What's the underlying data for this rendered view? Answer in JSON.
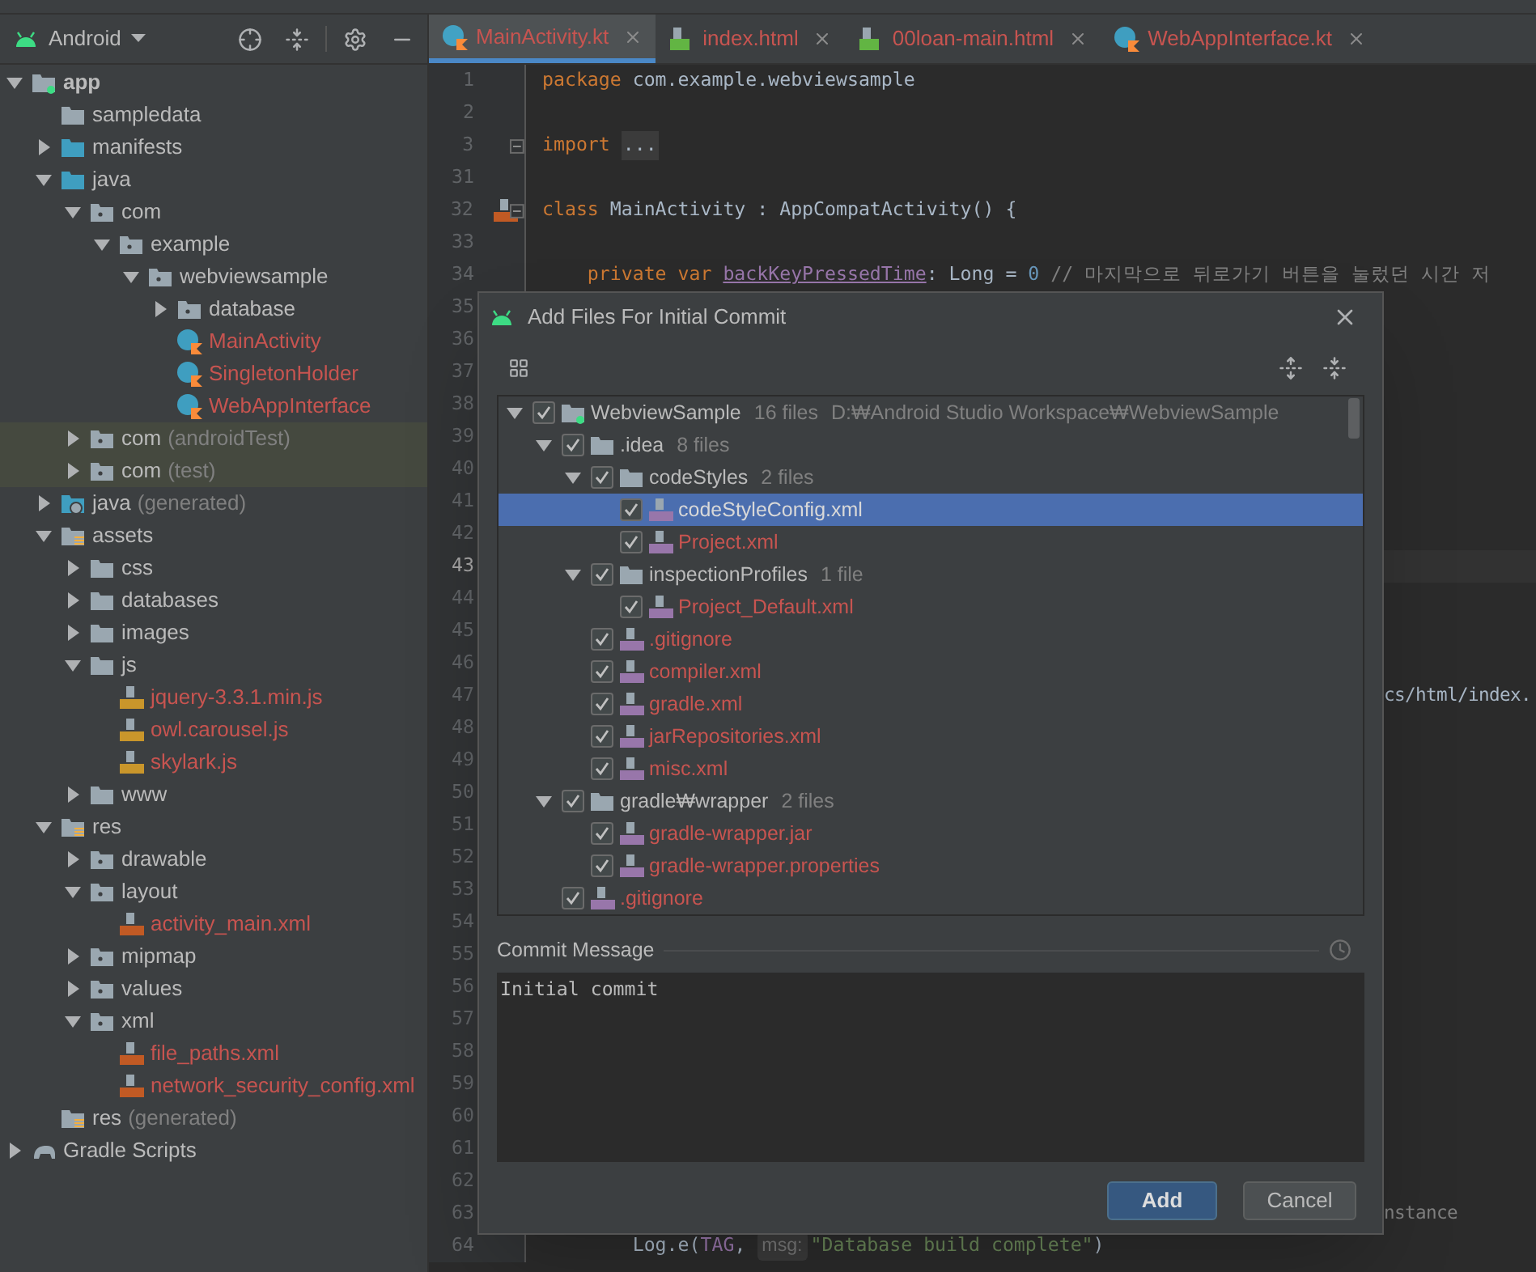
{
  "project_panel": {
    "view": "Android",
    "tree": [
      {
        "label": "app",
        "kind": "module",
        "expanded": true,
        "bold": true,
        "children": [
          {
            "label": "sampledata",
            "kind": "folder"
          },
          {
            "label": "manifests",
            "kind": "source",
            "expanded": false
          },
          {
            "label": "java",
            "kind": "source",
            "expanded": true,
            "children": [
              {
                "label": "com",
                "kind": "package",
                "expanded": true,
                "children": [
                  {
                    "label": "example",
                    "kind": "package",
                    "expanded": true,
                    "children": [
                      {
                        "label": "webviewsample",
                        "kind": "package",
                        "expanded": true,
                        "children": [
                          {
                            "label": "database",
                            "kind": "package",
                            "expanded": false
                          },
                          {
                            "label": "MainActivity",
                            "kind": "kotlin",
                            "unversioned": true
                          },
                          {
                            "label": "SingletonHolder",
                            "kind": "kotlin",
                            "unversioned": true
                          },
                          {
                            "label": "WebAppInterface",
                            "kind": "kotlin",
                            "unversioned": true
                          }
                        ]
                      }
                    ]
                  }
                ]
              },
              {
                "label": "com",
                "suffix": "(androidTest)",
                "kind": "package",
                "expanded": false,
                "highlighted": true
              },
              {
                "label": "com",
                "suffix": "(test)",
                "kind": "package",
                "expanded": false,
                "highlighted": true
              }
            ]
          },
          {
            "label": "java",
            "suffix": "(generated)",
            "kind": "generated",
            "expanded": false
          },
          {
            "label": "assets",
            "kind": "resources",
            "expanded": true,
            "children": [
              {
                "label": "css",
                "kind": "folder",
                "expanded": false
              },
              {
                "label": "databases",
                "kind": "folder",
                "expanded": false
              },
              {
                "label": "images",
                "kind": "folder",
                "expanded": false
              },
              {
                "label": "js",
                "kind": "folder",
                "expanded": true,
                "children": [
                  {
                    "label": "jquery-3.3.1.min.js",
                    "kind": "js",
                    "unversioned": true
                  },
                  {
                    "label": "owl.carousel.js",
                    "kind": "js",
                    "unversioned": true
                  },
                  {
                    "label": "skylark.js",
                    "kind": "js",
                    "unversioned": true
                  }
                ]
              },
              {
                "label": "www",
                "kind": "folder",
                "expanded": false
              }
            ]
          },
          {
            "label": "res",
            "kind": "resources",
            "expanded": true,
            "children": [
              {
                "label": "drawable",
                "kind": "package",
                "expanded": false
              },
              {
                "label": "layout",
                "kind": "package",
                "expanded": true,
                "children": [
                  {
                    "label": "activity_main.xml",
                    "kind": "xml",
                    "unversioned": true
                  }
                ]
              },
              {
                "label": "mipmap",
                "kind": "package",
                "expanded": false
              },
              {
                "label": "values",
                "kind": "package",
                "expanded": false
              },
              {
                "label": "xml",
                "kind": "package",
                "expanded": true,
                "children": [
                  {
                    "label": "file_paths.xml",
                    "kind": "xml",
                    "unversioned": true
                  },
                  {
                    "label": "network_security_config.xml",
                    "kind": "xml",
                    "unversioned": true
                  }
                ]
              }
            ]
          },
          {
            "label": "res",
            "suffix": "(generated)",
            "kind": "resources"
          }
        ]
      },
      {
        "label": "Gradle Scripts",
        "kind": "gradle",
        "expanded": false
      }
    ]
  },
  "tabs": [
    {
      "label": "MainActivity.kt",
      "kind": "kotlin",
      "selected": true
    },
    {
      "label": "index.html",
      "kind": "html",
      "selected": false
    },
    {
      "label": "00loan-main.html",
      "kind": "html",
      "selected": false
    },
    {
      "label": "WebAppInterface.kt",
      "kind": "kotlin",
      "selected": false
    }
  ],
  "editor": {
    "lines": [
      {
        "number": "1",
        "segments": [
          {
            "kind": "keyword",
            "text": "package "
          },
          {
            "kind": "plain",
            "text": "com.example.webviewsample"
          }
        ]
      },
      {
        "number": "2"
      },
      {
        "number": "3",
        "fold": true,
        "segments": [
          {
            "kind": "keyword",
            "text": "import "
          },
          {
            "kind": "folded",
            "text": "..."
          }
        ]
      },
      {
        "number": "31"
      },
      {
        "number": "32",
        "fold": true,
        "gutter_icon": true,
        "segments": [
          {
            "kind": "keyword",
            "text": "class "
          },
          {
            "kind": "plain",
            "text": "MainActivity : AppCompatActivity() {"
          }
        ]
      },
      {
        "number": "33"
      },
      {
        "number": "34",
        "segments": [
          {
            "kind": "keyword",
            "text": "    private var "
          },
          {
            "kind": "field",
            "text": "backKeyPressedTime"
          },
          {
            "kind": "plain",
            "text": ": Long = "
          },
          {
            "kind": "number",
            "text": "0"
          },
          {
            "kind": "comment",
            "text": " // 마지막으로 뒤로가기 버튼을 눌렀던 시간 저"
          }
        ]
      },
      {
        "number": "35"
      },
      {
        "number": "36"
      },
      {
        "number": "37"
      },
      {
        "number": "38"
      },
      {
        "number": "39"
      },
      {
        "number": "40"
      },
      {
        "number": "41"
      },
      {
        "number": "42"
      },
      {
        "number": "43",
        "current": true
      },
      {
        "number": "44"
      },
      {
        "number": "45"
      },
      {
        "number": "46"
      },
      {
        "number": "47",
        "tail": [
          {
            "kind": "plain",
            "text": "cs/html/index."
          }
        ]
      },
      {
        "number": "48"
      },
      {
        "number": "49"
      },
      {
        "number": "50"
      },
      {
        "number": "51"
      },
      {
        "number": "52"
      },
      {
        "number": "53"
      },
      {
        "number": "54"
      },
      {
        "number": "55"
      },
      {
        "number": "56"
      },
      {
        "number": "57"
      },
      {
        "number": "58"
      },
      {
        "number": "59"
      },
      {
        "number": "60"
      },
      {
        "number": "61"
      },
      {
        "number": "62"
      },
      {
        "number": "63",
        "tail": [
          {
            "kind": "comment",
            "text": "nstance"
          }
        ]
      },
      {
        "number": "64",
        "segments": [
          {
            "kind": "plain",
            "text": "        Log.e("
          },
          {
            "kind": "field_plain",
            "text": "TAG"
          },
          {
            "kind": "plain",
            "text": ", "
          },
          {
            "kind": "hint",
            "text": "msg:"
          },
          {
            "kind": "string",
            "text": "\"Database build complete\""
          },
          {
            "kind": "plain",
            "text": ")"
          }
        ]
      }
    ]
  },
  "dialog": {
    "title": "Add Files For Initial Commit",
    "tree": [
      {
        "label": "WebviewSample",
        "count": "16 files",
        "path": "D:₩Android Studio Workspace₩WebviewSample",
        "kind": "module",
        "checked": true,
        "expanded": true,
        "selected": false,
        "children": [
          {
            "label": ".idea",
            "count": "8 files",
            "kind": "folder",
            "checked": true,
            "expanded": true,
            "selected": false,
            "children": [
              {
                "label": "codeStyles",
                "count": "2 files",
                "kind": "folder",
                "checked": true,
                "expanded": true,
                "selected": false,
                "children": [
                  {
                    "label": "codeStyleConfig.xml",
                    "kind": "file",
                    "checked": true,
                    "selected": true
                  },
                  {
                    "label": "Project.xml",
                    "kind": "file",
                    "checked": true,
                    "selected": false
                  }
                ]
              },
              {
                "label": "inspectionProfiles",
                "count": "1 file",
                "kind": "folder",
                "checked": true,
                "expanded": true,
                "selected": false,
                "children": [
                  {
                    "label": "Project_Default.xml",
                    "kind": "file",
                    "checked": true,
                    "selected": false
                  }
                ]
              },
              {
                "label": ".gitignore",
                "kind": "file",
                "checked": true,
                "selected": false
              },
              {
                "label": "compiler.xml",
                "kind": "file",
                "checked": true,
                "selected": false
              },
              {
                "label": "gradle.xml",
                "kind": "file",
                "checked": true,
                "selected": false
              },
              {
                "label": "jarRepositories.xml",
                "kind": "file",
                "checked": true,
                "selected": false
              },
              {
                "label": "misc.xml",
                "kind": "file",
                "checked": true,
                "selected": false
              }
            ]
          },
          {
            "label": "gradle₩wrapper",
            "count": "2 files",
            "kind": "folder",
            "checked": true,
            "expanded": true,
            "selected": false,
            "children": [
              {
                "label": "gradle-wrapper.jar",
                "kind": "file",
                "checked": true,
                "selected": false
              },
              {
                "label": "gradle-wrapper.properties",
                "kind": "file",
                "checked": true,
                "selected": false
              }
            ]
          },
          {
            "label": ".gitignore",
            "kind": "file",
            "checked": true,
            "selected": false
          }
        ]
      }
    ],
    "commit_message": {
      "label": "Commit Message",
      "value": "Initial commit"
    },
    "buttons": [
      {
        "label": "Add",
        "kind": "primary"
      },
      {
        "label": "Cancel",
        "kind": "secondary"
      }
    ]
  }
}
